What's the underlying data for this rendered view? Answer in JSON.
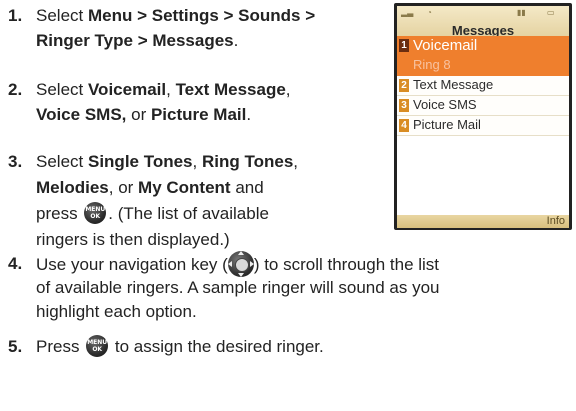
{
  "steps": [
    {
      "num": "1.",
      "lines": [
        [
          "Select ",
          {
            "b": "Menu > Settings > Sounds >"
          }
        ],
        [
          {
            "b": "Ringer Type > Messages"
          },
          "."
        ]
      ]
    },
    {
      "num": "2.",
      "lines": [
        [
          "Select ",
          {
            "b": "Voicemail"
          },
          ", ",
          {
            "b": "Text Message"
          },
          ","
        ],
        [
          {
            "b": "Voice SMS,"
          },
          " or ",
          {
            "b": "Picture Mail"
          },
          "."
        ]
      ]
    },
    {
      "num": "3.",
      "lines": [
        [
          "Select ",
          {
            "b": "Single Tones"
          },
          ", ",
          {
            "b": "Ring Tones"
          },
          ","
        ],
        [
          {
            "b": "Melodies"
          },
          ", or ",
          {
            "b": "My Content"
          },
          " and"
        ],
        [
          "press ",
          {
            "icon": "menu"
          },
          ". (The list of available"
        ],
        [
          "ringers is then displayed.)"
        ]
      ]
    },
    {
      "num": "4.",
      "lines": [
        [
          "Use your navigation key (",
          {
            "icon": "nav"
          },
          ") to scroll through the list"
        ],
        [
          "of available ringers. A sample ringer will sound as you"
        ],
        [
          "highlight each option."
        ]
      ]
    },
    {
      "num": "5.",
      "lines": [
        [
          "Press ",
          {
            "icon": "menu"
          },
          " to assign the desired ringer."
        ]
      ]
    }
  ],
  "icons": {
    "menu": {
      "name": "menu-ok-key-icon",
      "top": "MENU",
      "bottom": "OK"
    },
    "nav": {
      "name": "navigation-key-icon"
    }
  },
  "phone": {
    "title": "Messages",
    "items": [
      {
        "num": "1",
        "label": "Voicemail",
        "sub": "Ring 8",
        "selected": true
      },
      {
        "num": "2",
        "label": "Text Message"
      },
      {
        "num": "3",
        "label": "Voice SMS"
      },
      {
        "num": "4",
        "label": "Picture Mail"
      }
    ],
    "softkey": "Info"
  }
}
